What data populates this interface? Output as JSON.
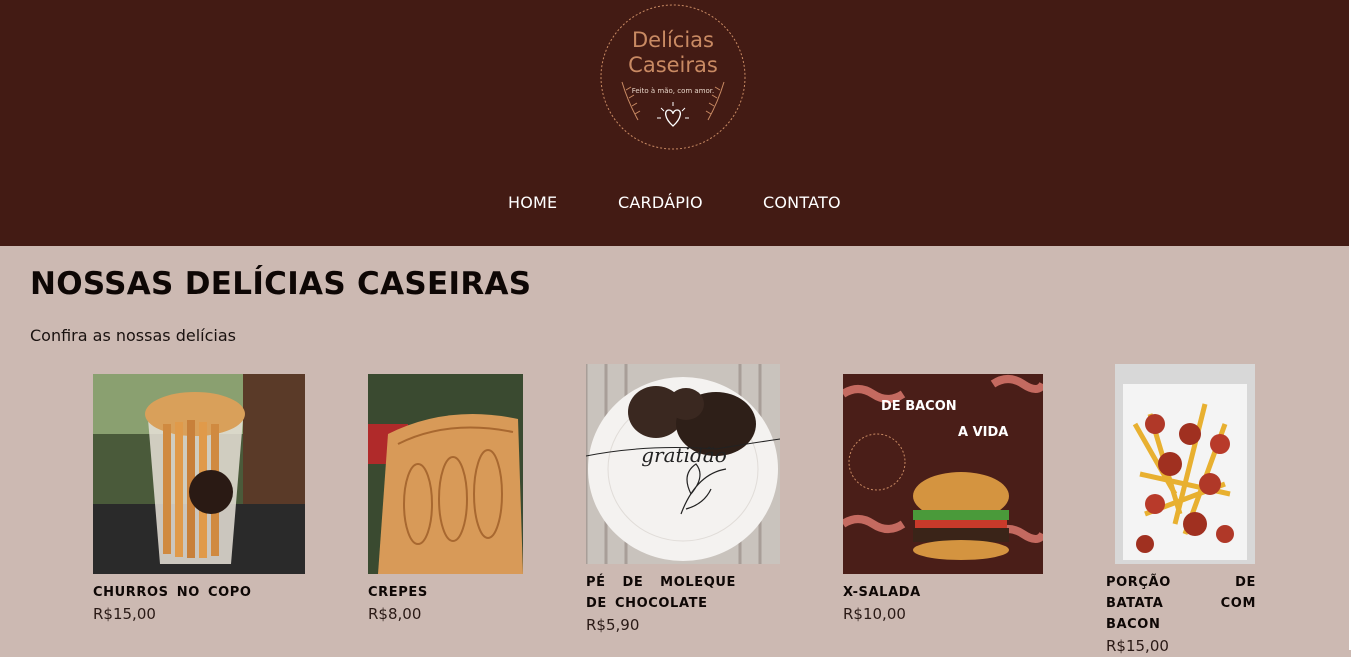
{
  "brand": {
    "logo_line1": "Delícias",
    "logo_line2": "Caseiras",
    "tagline": "Feito à mão, com amor."
  },
  "colors": {
    "header_bg": "#431b14",
    "page_bg": "#ccb9b2",
    "logo_accent": "#c98a63"
  },
  "nav": {
    "items": [
      {
        "label": "HOME"
      },
      {
        "label": "CARDÁPIO"
      },
      {
        "label": "CONTATO"
      }
    ]
  },
  "main": {
    "title": "NOSSAS DELÍCIAS CASEIRAS",
    "subtitle": "Confira as nossas delícias"
  },
  "products": [
    {
      "name": "CHURROS NO COPO",
      "price": "R$15,00",
      "image_icon": "churros-cup-photo"
    },
    {
      "name": "CREPES",
      "price": "R$8,00",
      "image_icon": "crepe-photo"
    },
    {
      "name": "PÉ DE MOLEQUE DE CHOCOLATE",
      "price": "R$5,90",
      "image_icon": "chocolate-plate-photo",
      "image_text": "gratidão"
    },
    {
      "name": "X-SALADA",
      "price": "R$10,00",
      "image_icon": "burger-poster-photo",
      "image_text_1": "DE BACON",
      "image_text_2": "A VIDA"
    },
    {
      "name": "PORÇÃO DE BATATA COM BACON",
      "price": "R$15,00",
      "image_icon": "fries-bacon-photo"
    }
  ]
}
